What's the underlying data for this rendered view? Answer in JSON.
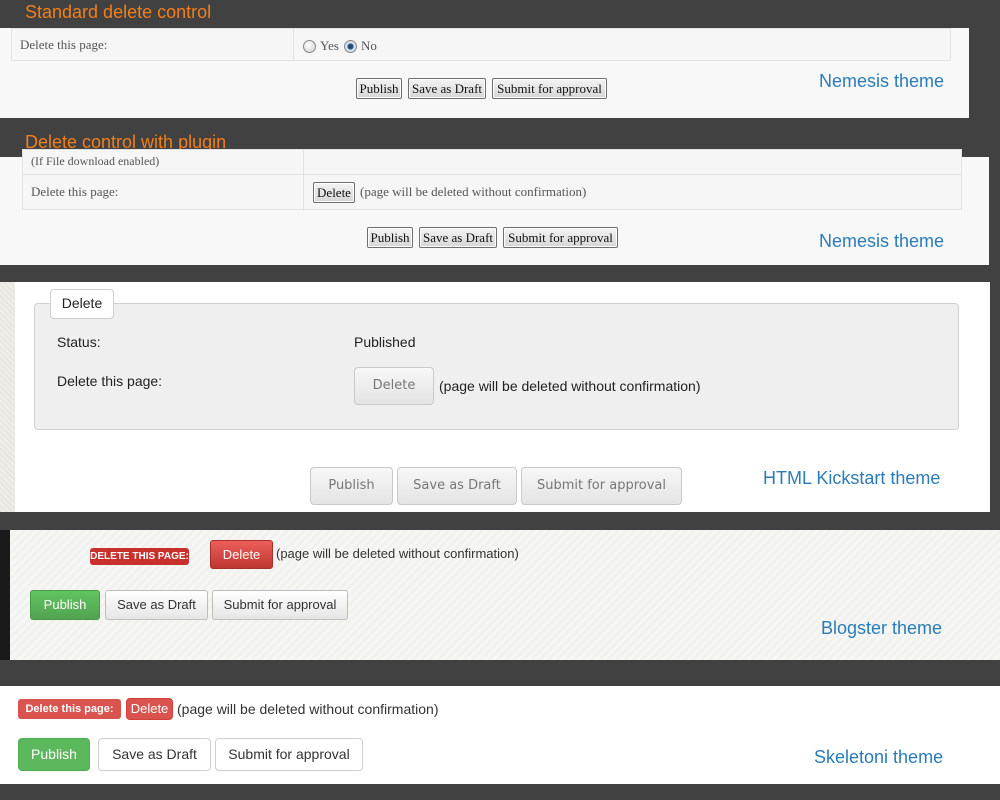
{
  "section1": {
    "heading": "Standard delete control",
    "delete_label": "Delete this page:",
    "option_yes": "Yes",
    "option_no": "No",
    "selected_option": "No",
    "buttons": {
      "publish": "Publish",
      "draft": "Save as Draft",
      "submit": "Submit for approval"
    },
    "theme": "Nemesis theme"
  },
  "section2": {
    "heading": "Delete control with plugin",
    "clipped_row_text": "(If File download enabled)",
    "delete_label": "Delete this page:",
    "delete_button": "Delete",
    "delete_note": "(page will be deleted without confirmation)",
    "buttons": {
      "publish": "Publish",
      "draft": "Save as Draft",
      "submit": "Submit for approval"
    },
    "theme": "Nemesis theme"
  },
  "section3": {
    "legend": "Delete",
    "status_label": "Status:",
    "status_value": "Published",
    "delete_label": "Delete this page:",
    "delete_button": "Delete",
    "delete_note": "(page will be deleted without confirmation)",
    "buttons": {
      "publish": "Publish",
      "draft": "Save as Draft",
      "submit": "Submit for approval"
    },
    "theme": "HTML Kickstart theme"
  },
  "section4": {
    "delete_label": "DELETE THIS PAGE:",
    "delete_button": "Delete",
    "delete_note": "(page will be deleted without confirmation)",
    "buttons": {
      "publish": "Publish",
      "draft": "Save as Draft",
      "submit": "Submit for approval"
    },
    "theme": "Blogster theme"
  },
  "section5": {
    "delete_label": "Delete this page:",
    "delete_button": "Delete",
    "delete_note": "(page will be deleted without confirmation)",
    "buttons": {
      "publish": "Publish",
      "draft": "Save as Draft",
      "submit": "Submit for approval"
    },
    "theme": "Skeletoni theme"
  },
  "colors": {
    "heading": "#f07f1c",
    "theme_label": "#2a7cb8",
    "danger": "#d9534f",
    "success": "#5cb85c"
  }
}
